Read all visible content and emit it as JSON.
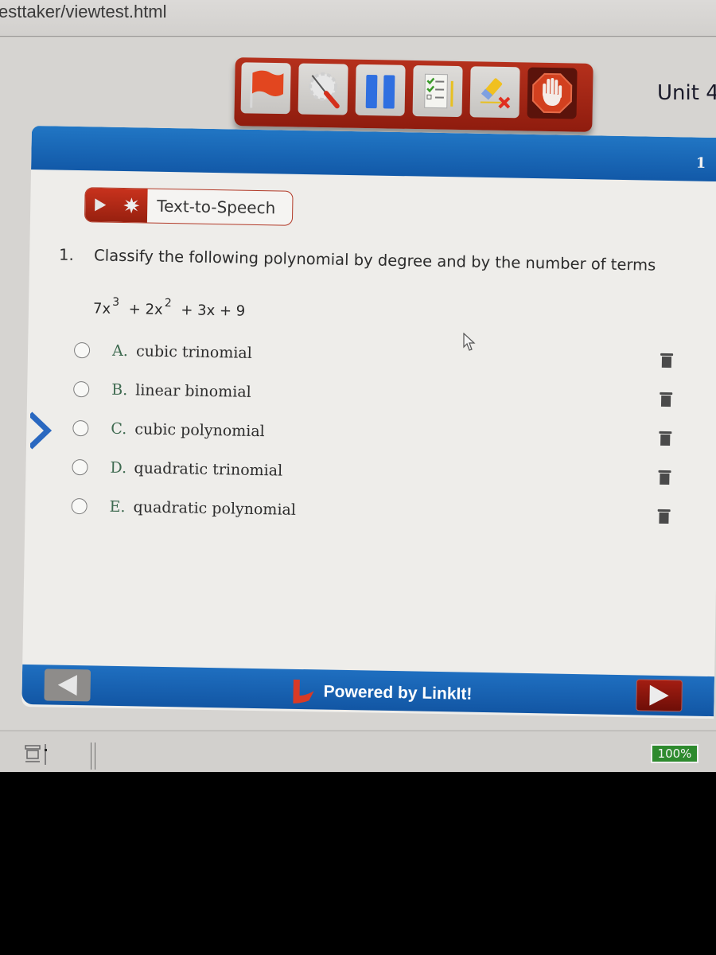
{
  "browser": {
    "url": "esttaker/viewtest.html"
  },
  "toolbar": {
    "buttons": [
      {
        "name": "flag",
        "icon": "flag-icon"
      },
      {
        "name": "tools",
        "icon": "tools-icon"
      },
      {
        "name": "pause",
        "icon": "pause-icon"
      },
      {
        "name": "review",
        "icon": "checklist-icon"
      },
      {
        "name": "eraser",
        "icon": "eraser-icon"
      },
      {
        "name": "stop",
        "icon": "stop-hand-icon"
      }
    ]
  },
  "header": {
    "unit_label": "Unit 4",
    "page_number": "1"
  },
  "tts": {
    "label": "Text-to-Speech"
  },
  "question": {
    "number": "1.",
    "prompt": "Classify the following polynomial by degree and by the number of terms",
    "expression": {
      "t1_coef": "7x",
      "t1_exp": "3",
      "t2_coef": "+ 2x",
      "t2_exp": "2",
      "rest": "+ 3x + 9"
    },
    "choices": [
      {
        "letter": "A.",
        "text": "cubic trinomial",
        "selected": false
      },
      {
        "letter": "B.",
        "text": "linear binomial",
        "selected": false
      },
      {
        "letter": "C.",
        "text": "cubic polynomial",
        "selected": false
      },
      {
        "letter": "D.",
        "text": "quadratic trinomial",
        "selected": false
      },
      {
        "letter": "E.",
        "text": "quadratic polynomial",
        "selected": false
      }
    ]
  },
  "footer": {
    "powered_by": "Powered by LinkIt!"
  },
  "statusbar": {
    "zoom": "100%"
  },
  "colors": {
    "brand_blue": "#1a68b8",
    "brand_red": "#b02a18",
    "zoom_green": "#2e8a2e"
  }
}
